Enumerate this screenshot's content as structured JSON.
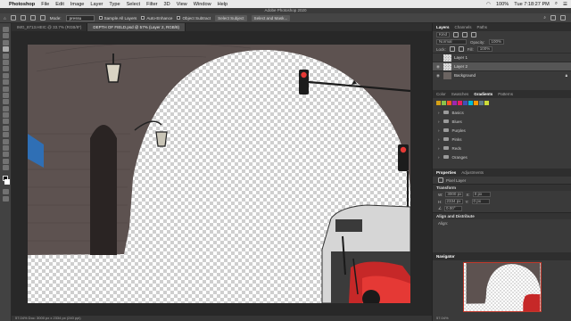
{
  "menubar": {
    "app_name": "Photoshop",
    "items": [
      "File",
      "Edit",
      "Image",
      "Layer",
      "Type",
      "Select",
      "Filter",
      "3D",
      "View",
      "Window",
      "Help"
    ],
    "battery": "100%",
    "clock": "Tue 7:18:27 PM"
  },
  "window": {
    "title": "Adobe Photoshop 2020"
  },
  "options": {
    "mode_label": "Mode:",
    "brush_preset": "pressu",
    "sample_all_layers": "Sample All Layers",
    "auto_enhance": "Auto-Enhance",
    "object_subtract": "Object Subtract",
    "select_subject": "Select Subject",
    "select_and_mask": "Select and Mask..."
  },
  "tabs": [
    {
      "label": "IMG_8713.HEIC @ 33.7% (RGB/8*)",
      "active": false
    },
    {
      "label": "DEPTH OF FIELD.psd @ 57% (Layer 2, RGB/8)",
      "active": true
    }
  ],
  "status": {
    "text": "57.04%   Doc: 3000 px x 2334 px (240 ppi)"
  },
  "layers_panel": {
    "tabs": [
      "Layers",
      "Channels",
      "Paths"
    ],
    "kind": "Kind",
    "blend_mode": "Normal",
    "opacity_label": "Opacity:",
    "opacity": "100%",
    "lock_label": "Lock:",
    "fill_label": "Fill:",
    "fill": "100%",
    "layers": [
      {
        "name": "Layer 1",
        "selected": false,
        "visible": false
      },
      {
        "name": "Layer 2",
        "selected": true,
        "visible": true
      },
      {
        "name": "Background",
        "selected": false,
        "visible": true
      }
    ]
  },
  "gradients_panel": {
    "tabs": [
      "Color",
      "Swatches",
      "Gradients",
      "Patterns"
    ],
    "swatches": [
      "#d4a017",
      "#8bc34a",
      "#ff5722",
      "#9c27b0",
      "#e91e63",
      "#3f51b5",
      "#00bcd4",
      "#ff9800",
      "#607d8b",
      "#cddc39"
    ],
    "folders": [
      "Basics",
      "Blues",
      "Purples",
      "Pinks",
      "Reds",
      "Oranges"
    ]
  },
  "properties_panel": {
    "tabs": [
      "Properties",
      "Adjustments"
    ],
    "layer_type": "Pixel Layer",
    "transform_label": "Transform",
    "w_label": "W:",
    "w": "3000 px",
    "h_label": "H:",
    "h": "2334 px",
    "x_label": "X:",
    "x": "0 px",
    "y_label": "Y:",
    "y": "0 px",
    "angle": "0.00°",
    "align_label": "Align and Distribute",
    "align_sub": "Align:"
  },
  "navigator": {
    "title": "Navigator",
    "zoom": "57.04%"
  }
}
